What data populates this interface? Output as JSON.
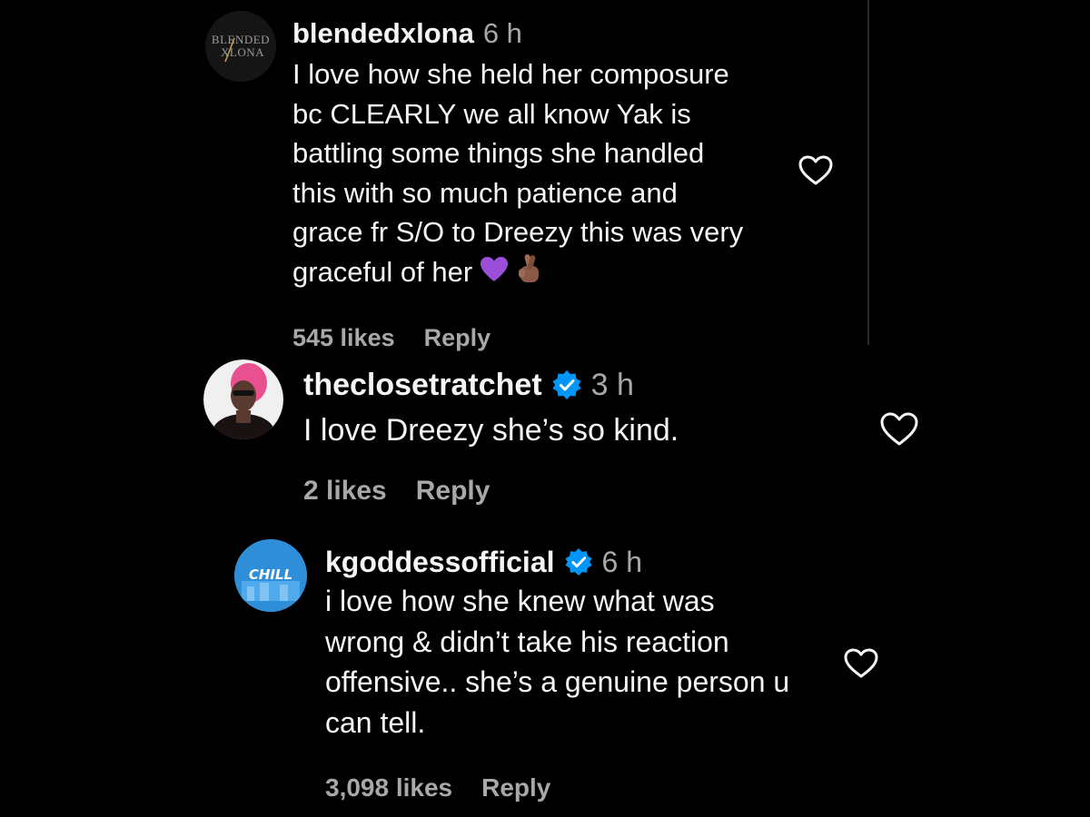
{
  "comments": [
    {
      "username": "blendedxlona",
      "time": "6 h",
      "verified": false,
      "text": "I love how she held her composure\nbc CLEARLY we all know Yak is\nbattling some things she handled\nthis with so much patience and\ngrace fr S/O to Dreezy this was very\ngraceful of her",
      "emojis": [
        "purple-heart",
        "fingers-crossed"
      ],
      "likes": "545 likes",
      "reply": "Reply",
      "avatar_text": "BLENDED XLONA"
    },
    {
      "username": "theclosetratchet",
      "time": "3 h",
      "verified": true,
      "text": "I love Dreezy she’s so kind.",
      "likes": "2 likes",
      "reply": "Reply"
    },
    {
      "username": "kgoddessofficial",
      "time": "6 h",
      "verified": true,
      "text": "i love how she knew what was\nwrong & didn’t take his reaction\noffensive.. she’s a genuine person u\ncan tell.",
      "likes": "3,098 likes",
      "reply": "Reply",
      "avatar_text": "CHILL"
    }
  ],
  "colors": {
    "background": "#000000",
    "text": "#f5f5f5",
    "secondary": "#a8a8a8",
    "verified": "#0095f6",
    "purple_heart": "#9b4fd9"
  }
}
